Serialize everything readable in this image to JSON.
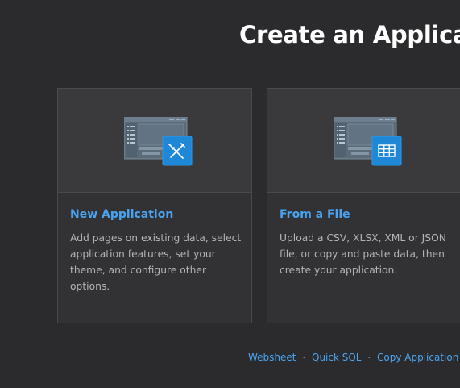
{
  "page": {
    "title": "Create an Applicati"
  },
  "cards": [
    {
      "title": "New Application",
      "description": "Add pages on existing data, select application features, set your theme, and configure other options.",
      "badge_icon": "edit-pencil-ruler-icon"
    },
    {
      "title": "From a File",
      "description": "Upload a CSV, XLSX, XML or JSON file, or copy and paste data, then create your application.",
      "badge_icon": "table-grid-icon"
    }
  ],
  "footer": {
    "links": [
      "Websheet",
      "Quick SQL",
      "Copy Application"
    ],
    "separator": "·"
  },
  "colors": {
    "accent": "#4aa3f0",
    "badge": "#1e88d6",
    "background": "#2b2b2d"
  }
}
